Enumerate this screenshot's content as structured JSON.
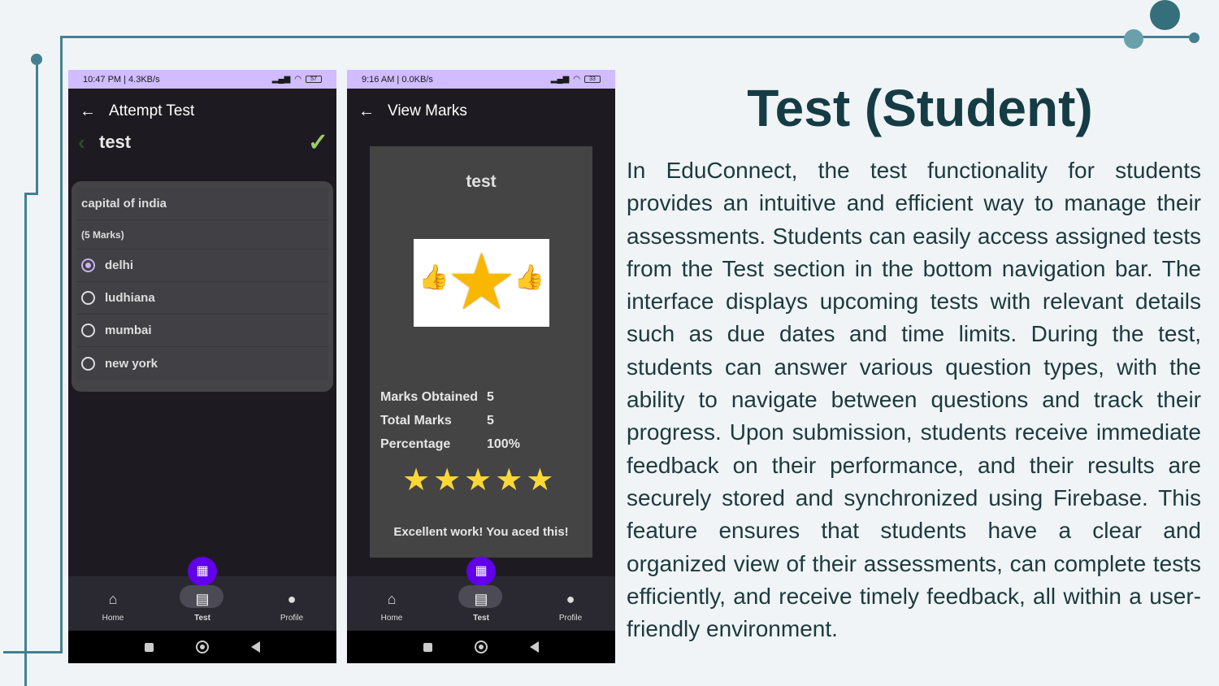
{
  "phone1": {
    "status": {
      "time": "10:47 PM | 4.3KB/s",
      "battery": "57"
    },
    "appbar_title": "Attempt Test",
    "test_name": "test",
    "question": "capital of india",
    "marks": "(5 Marks)",
    "options": [
      {
        "label": "delhi",
        "selected": true
      },
      {
        "label": "ludhiana",
        "selected": false
      },
      {
        "label": "mumbai",
        "selected": false
      },
      {
        "label": "new york",
        "selected": false
      }
    ],
    "nav": {
      "home": "Home",
      "test": "Test",
      "profile": "Profile"
    }
  },
  "phone2": {
    "status": {
      "time": "9:16 AM | 0.0KB/s",
      "battery": "33"
    },
    "appbar_title": "View Marks",
    "test_name": "test",
    "stats": [
      {
        "label": "Marks Obtained",
        "value": "5"
      },
      {
        "label": "Total Marks",
        "value": "5"
      },
      {
        "label": "Percentage",
        "value": "100%"
      }
    ],
    "rating_stars": 5,
    "message": "Excellent work! You aced this!",
    "nav": {
      "home": "Home",
      "test": "Test",
      "profile": "Profile"
    }
  },
  "slide": {
    "title": "Test (Student)",
    "body": "In EduConnect, the test functionality for students provides an intuitive and efficient way to manage their assessments. Students can easily access assigned tests from the Test section in the bottom navigation bar. The interface displays upcoming tests with relevant details such as due dates and time limits. During the test, students can answer various question types, with the ability to navigate between questions and track their progress. Upon submission, students receive immediate feedback on their performance, and their results are securely stored and synchronized using Firebase. This feature ensures that students have a clear and organized view of their assessments, can complete tests efficiently, and receive timely feedback, all within a user-friendly environment."
  },
  "colors": {
    "accent": "#44808f",
    "title": "#153c44",
    "statusbar": "#d0bcff",
    "fab": "#6200ea"
  }
}
